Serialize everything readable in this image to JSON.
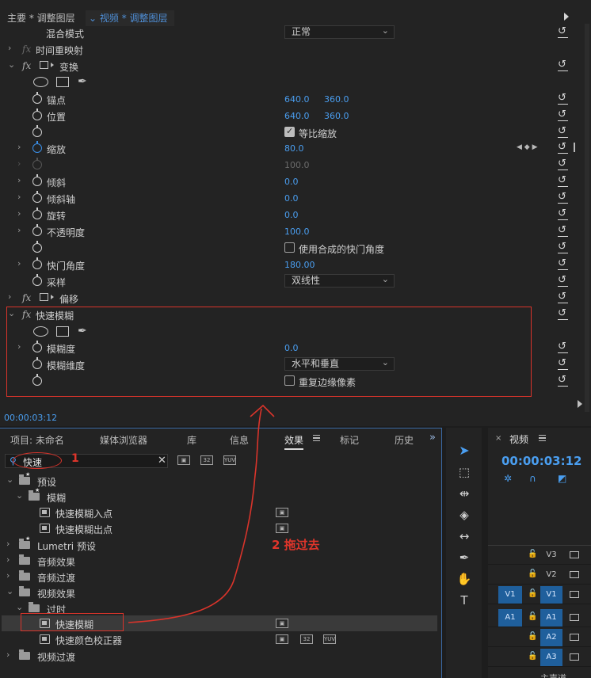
{
  "effect_controls": {
    "tab_main": "主要 * 调整图层",
    "tab_clip": "视频 * 调整图层",
    "blend_mode_label": "混合模式",
    "blend_mode_value": "正常",
    "time_remap": "时间重映射",
    "transform": "变换",
    "anchor": {
      "label": "锚点",
      "x": "640.0",
      "y": "360.0"
    },
    "position": {
      "label": "位置",
      "x": "640.0",
      "y": "360.0"
    },
    "uniform_scale": "等比缩放",
    "scale": {
      "label": "缩放",
      "value": "80.0"
    },
    "scale_width": "100.0",
    "skew": {
      "label": "倾斜",
      "value": "0.0"
    },
    "skew_axis": {
      "label": "倾斜轴",
      "value": "0.0"
    },
    "rotation": {
      "label": "旋转",
      "value": "0.0"
    },
    "opacity": {
      "label": "不透明度",
      "value": "100.0"
    },
    "comp_shutter": "使用合成的快门角度",
    "shutter_angle": {
      "label": "快门角度",
      "value": "180.00"
    },
    "sampling": {
      "label": "采样",
      "value": "双线性"
    },
    "offset": "偏移",
    "fast_blur": "快速模糊",
    "blurriness": {
      "label": "模糊度",
      "value": "0.0"
    },
    "blur_dimensions": {
      "label": "模糊维度",
      "value": "水平和垂直"
    },
    "repeat_edge": "重复边缘像素",
    "timecode": "00:00:03:12"
  },
  "effects_panel": {
    "tabs": [
      "项目: 未命名",
      "媒体浏览器",
      "库",
      "信息",
      "效果",
      "标记",
      "历史"
    ],
    "more_tabs": "»",
    "search_value": "快速",
    "badges": [
      "32",
      "YUV"
    ],
    "annotation_1": "1",
    "tree": {
      "presets": "预设",
      "blur_folder": "模糊",
      "fast_blur_in": "快速模糊入点",
      "fast_blur_out": "快速模糊出点",
      "lumetri": "Lumetri 预设",
      "audio_effects": "音频效果",
      "audio_transitions": "音频过渡",
      "video_effects": "视频效果",
      "obsolete": "过时",
      "fast_blur": "快速模糊",
      "fast_color": "快速颜色校正器",
      "video_transitions": "视频过渡"
    },
    "annotation_2": "2 拖过去"
  },
  "timeline": {
    "title": "视频",
    "timecode": "00:00:03:12",
    "tracks": [
      {
        "src": "",
        "name": "V3"
      },
      {
        "src": "",
        "name": "V2"
      },
      {
        "src": "V1",
        "name": "V1"
      },
      {
        "src": "A1",
        "name": "A1"
      },
      {
        "src": "",
        "name": "A2"
      },
      {
        "src": "",
        "name": "A3"
      }
    ],
    "master": "主声道"
  }
}
